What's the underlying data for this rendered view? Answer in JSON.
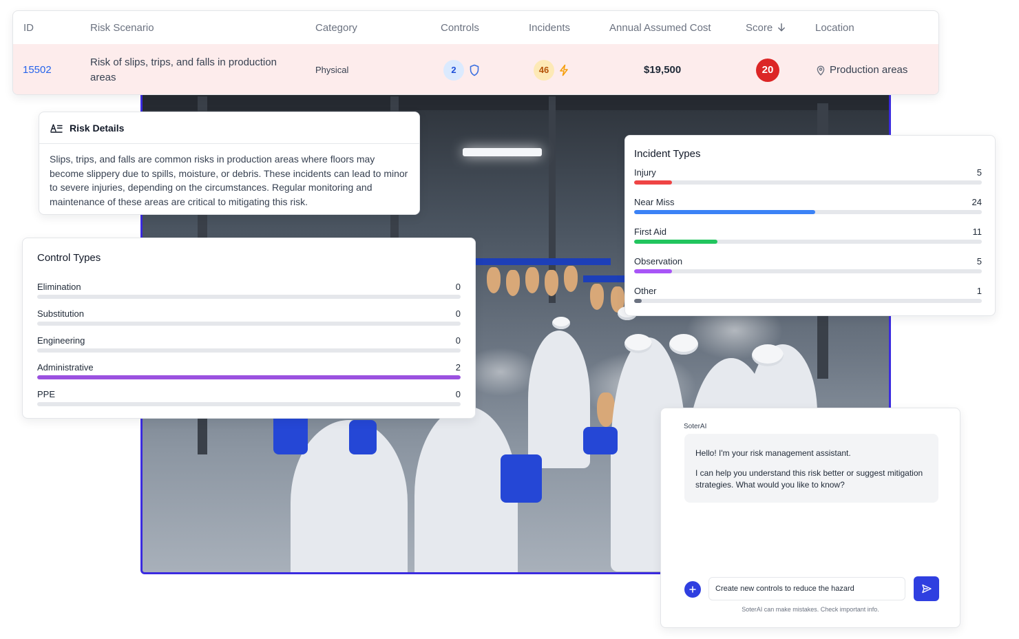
{
  "table": {
    "headers": {
      "id": "ID",
      "scenario": "Risk Scenario",
      "category": "Category",
      "controls": "Controls",
      "incidents": "Incidents",
      "cost": "Annual Assumed Cost",
      "score": "Score",
      "location": "Location"
    },
    "row": {
      "id": "15502",
      "scenario": "Risk of slips, trips, and falls in production areas",
      "category": "Physical",
      "controls": "2",
      "incidents": "46",
      "cost": "$19,500",
      "score": "20",
      "location": "Production areas"
    }
  },
  "details": {
    "title": "Risk Details",
    "text": "Slips, trips, and falls are common risks in production areas where floors may become slippery due to spills, moisture, or debris. These incidents can lead to minor to severe injuries, depending on the circumstances. Regular monitoring and maintenance of these areas are critical to mitigating this risk."
  },
  "control_types": {
    "title": "Control Types",
    "max": 2,
    "items": [
      {
        "label": "Elimination",
        "value": 0,
        "color": "#9b51e0"
      },
      {
        "label": "Substitution",
        "value": 0,
        "color": "#9b51e0"
      },
      {
        "label": "Engineering",
        "value": 0,
        "color": "#9b51e0"
      },
      {
        "label": "Administrative",
        "value": 2,
        "color": "#9b51e0"
      },
      {
        "label": "PPE",
        "value": 0,
        "color": "#9b51e0"
      }
    ]
  },
  "incident_types": {
    "title": "Incident Types",
    "total": 46,
    "items": [
      {
        "label": "Injury",
        "value": 5,
        "color": "#ef4444"
      },
      {
        "label": "Near Miss",
        "value": 24,
        "color": "#3b82f6"
      },
      {
        "label": "First Aid",
        "value": 11,
        "color": "#22c55e"
      },
      {
        "label": "Observation",
        "value": 5,
        "color": "#a855f7"
      },
      {
        "label": "Other",
        "value": 1,
        "color": "#6b7280"
      }
    ]
  },
  "chat": {
    "assistant_name": "SoterAI",
    "greeting": "Hello! I'm your risk management assistant.",
    "message": "I can help you understand this risk better or suggest mitigation strategies. What would you like to know?",
    "input_value": "Create new controls to reduce the hazard",
    "disclaimer": "SoterAI can make mistakes. Check important info."
  },
  "colors": {
    "accent": "#2f3fe0",
    "link": "#2563eb",
    "score": "#dc2626",
    "row_highlight": "#fdecec"
  },
  "icons": {
    "controls": "shield-icon",
    "incidents": "lightning-icon",
    "location": "map-pin-icon",
    "sort": "arrow-down-icon",
    "details": "text-align-icon",
    "add": "plus-icon",
    "send": "send-icon"
  }
}
